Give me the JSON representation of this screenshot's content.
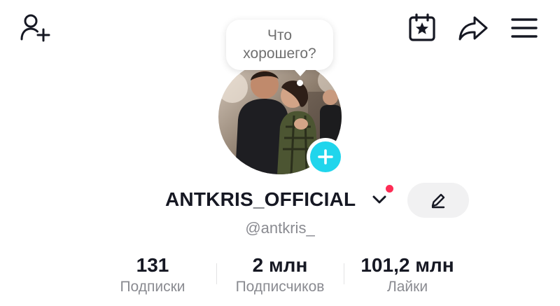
{
  "header": {
    "icons": [
      "add-friend-icon",
      "calendar-star-icon",
      "share-icon",
      "menu-icon"
    ]
  },
  "avatar_prompt": {
    "text": "Что\nхорошего?"
  },
  "profile": {
    "username": "ANTKRIS_OFFICIAL",
    "handle": "@antkris_",
    "has_notification_dot": true
  },
  "stats": [
    {
      "value": "131",
      "label": "Подписки"
    },
    {
      "value": "2 млн",
      "label": "Подписчиков"
    },
    {
      "value": "101,2 млн",
      "label": "Лайки"
    }
  ],
  "colors": {
    "accent_plus": "#20d5ec",
    "notification": "#fe2c55",
    "text_primary": "#161823",
    "text_secondary": "#8a8b91"
  }
}
